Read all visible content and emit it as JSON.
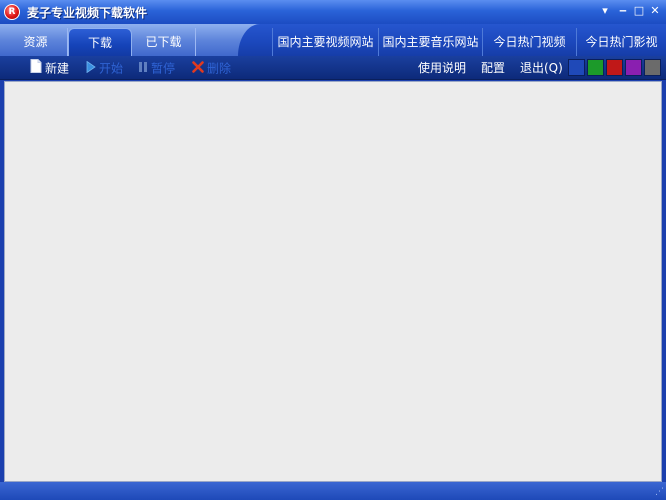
{
  "window": {
    "title": "麦子专业视频下载软件",
    "icon_letter": "R",
    "controls": {
      "dropdown_icon": "▾",
      "minimize_icon": "‒",
      "maximize_icon": "□",
      "close_icon": "✕"
    }
  },
  "tabs": {
    "left": [
      {
        "label": "资源",
        "active": false
      },
      {
        "label": "下载",
        "active": true
      },
      {
        "label": "已下载",
        "active": false
      }
    ],
    "right": [
      {
        "label": "国内主要视频网站"
      },
      {
        "label": "国内主要音乐网站"
      },
      {
        "label": "今日热门视频"
      },
      {
        "label": "今日热门影视"
      }
    ]
  },
  "toolbar": {
    "new_label": "新建",
    "start_label": "开始",
    "pause_label": "暂停",
    "delete_label": "删除",
    "help_label": "使用说明",
    "settings_label": "配置",
    "exit_label": "退出(Q)",
    "swatches": [
      "#1f49b8",
      "#1c9a2a",
      "#c01818",
      "#8a1fb0",
      "#6b6b6b"
    ]
  },
  "colors": {
    "title_bar": "#2a63d8",
    "active_tab": "#1543b8",
    "toolbar": "#0d2a7a",
    "content_bg": "#ececec"
  }
}
